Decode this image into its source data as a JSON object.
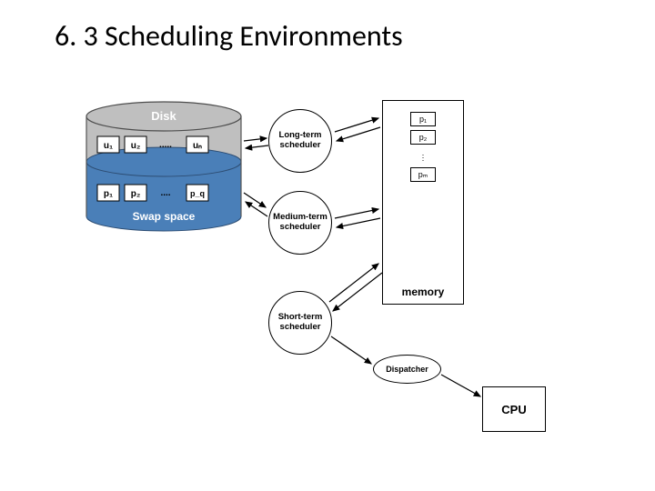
{
  "title": "6. 3 Scheduling Environments",
  "disk": {
    "label": "Disk",
    "swap_label": "Swap space",
    "user_items": [
      "u₁",
      "u₂",
      "uₙ"
    ],
    "user_ellipsis": ".....",
    "swap_items": [
      "p₁",
      "p₂",
      "p_q"
    ],
    "swap_ellipsis": "...."
  },
  "schedulers": {
    "long": "Long-term scheduler",
    "medium": "Medium-term scheduler",
    "short": "Short-term scheduler"
  },
  "memory": {
    "label": "memory",
    "slots": [
      "p₁",
      "p₂",
      "pₘ"
    ]
  },
  "dispatcher": "Dispatcher",
  "cpu": "CPU"
}
